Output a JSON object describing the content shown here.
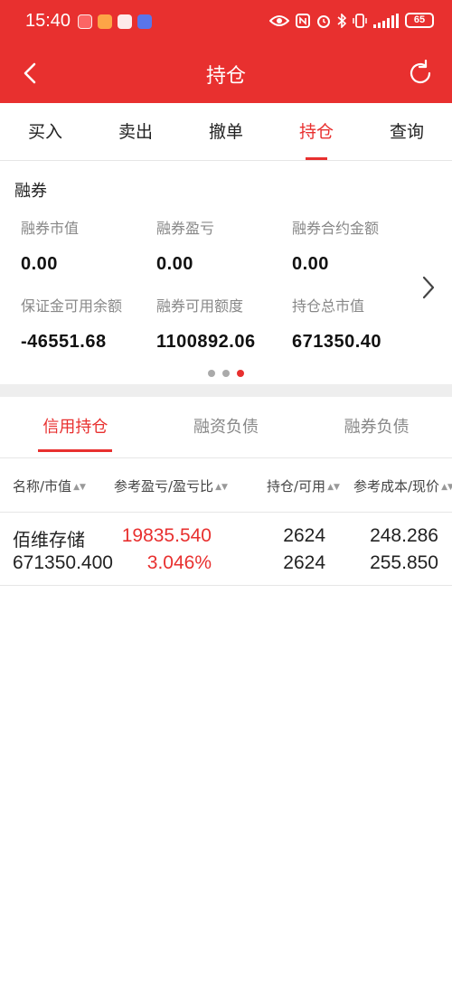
{
  "status_bar": {
    "time": "15:40",
    "battery": "65",
    "icons": [
      "eye-icon",
      "nfc-icon",
      "alarm-icon",
      "bluetooth-icon",
      "vibrate-icon",
      "signal-icon",
      "battery-icon"
    ]
  },
  "header": {
    "title": "持仓",
    "back_icon": "chevron-left-icon",
    "refresh_icon": "refresh-icon",
    "color": "#e8302f"
  },
  "top_tabs": [
    {
      "label": "买入"
    },
    {
      "label": "卖出"
    },
    {
      "label": "撤单"
    },
    {
      "label": "持仓",
      "active": true
    },
    {
      "label": "查询"
    }
  ],
  "summary": {
    "section_title": "融券",
    "metrics": [
      {
        "label": "融券市值",
        "value": "0.00"
      },
      {
        "label": "融券盈亏",
        "value": "0.00"
      },
      {
        "label": "融券合约金额",
        "value": "0.00"
      },
      {
        "label": "保证金可用余额",
        "value": "-46551.68"
      },
      {
        "label": "融券可用额度",
        "value": "1100892.06"
      },
      {
        "label": "持仓总市值",
        "value": "671350.40"
      }
    ],
    "page_dots": 3,
    "active_dot": 3
  },
  "holding_tabs": [
    {
      "label": "信用持仓",
      "active": true
    },
    {
      "label": "融资负债"
    },
    {
      "label": "融券负债"
    }
  ],
  "columns": [
    {
      "label": "名称/市值"
    },
    {
      "label": "参考盈亏/盈亏比"
    },
    {
      "label": "持仓/可用"
    },
    {
      "label": "参考成本/现价"
    }
  ],
  "rows": [
    {
      "name": "佰维存储",
      "market_value": "671350.400",
      "pnl": "19835.540",
      "pnl_ratio": "3.046%",
      "position": "2624",
      "available": "2624",
      "cost": "248.286",
      "price": "255.850"
    }
  ]
}
